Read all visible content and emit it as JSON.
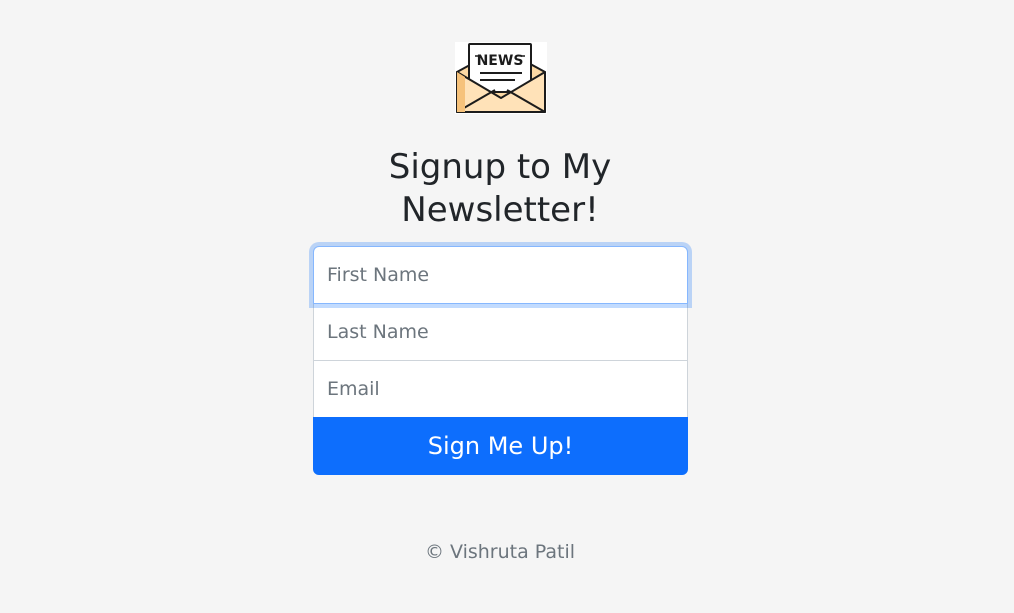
{
  "logo": {
    "icon": "news-envelope-icon",
    "text": "NEWS"
  },
  "heading": {
    "title": "Signup to My Newsletter!"
  },
  "form": {
    "first_name": {
      "placeholder": "First Name",
      "value": ""
    },
    "last_name": {
      "placeholder": "Last Name",
      "value": ""
    },
    "email": {
      "placeholder": "Email",
      "value": ""
    },
    "submit_label": "Sign Me Up!"
  },
  "footer": {
    "copyright": "© Vishruta Patil"
  },
  "colors": {
    "background": "#f5f5f5",
    "primary": "#0d6efd",
    "focus_border": "#86b7fe",
    "text": "#212529",
    "muted": "#6c757d"
  }
}
